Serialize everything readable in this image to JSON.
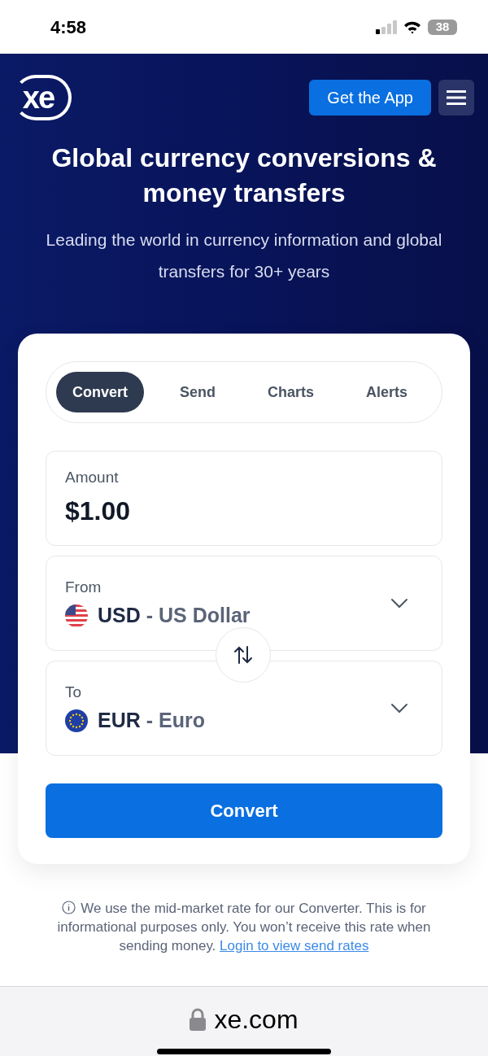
{
  "status_bar": {
    "time": "4:58",
    "battery": "38"
  },
  "header": {
    "logo": "xe",
    "app_button": "Get the App"
  },
  "hero": {
    "title": "Global currency conversions & money transfers",
    "subtitle": "Leading the world in currency information and global transfers for 30+ years"
  },
  "tabs": [
    {
      "label": "Convert",
      "selected": true
    },
    {
      "label": "Send",
      "selected": false
    },
    {
      "label": "Charts",
      "selected": false
    },
    {
      "label": "Alerts",
      "selected": false
    }
  ],
  "amount": {
    "label": "Amount",
    "value": "$1.00"
  },
  "from": {
    "label": "From",
    "code": "USD",
    "separator": "-",
    "name": "US Dollar",
    "kind": "us"
  },
  "to": {
    "label": "To",
    "code": "EUR",
    "separator": "-",
    "name": "Euro",
    "kind": "eu"
  },
  "convert_button": "Convert",
  "disclaimer": {
    "text": "We use the mid-market rate for our Converter. This is for informational purposes only. You won’t receive this rate when sending money.",
    "link": "Login to view send rates"
  },
  "browser": {
    "url": "xe.com"
  }
}
